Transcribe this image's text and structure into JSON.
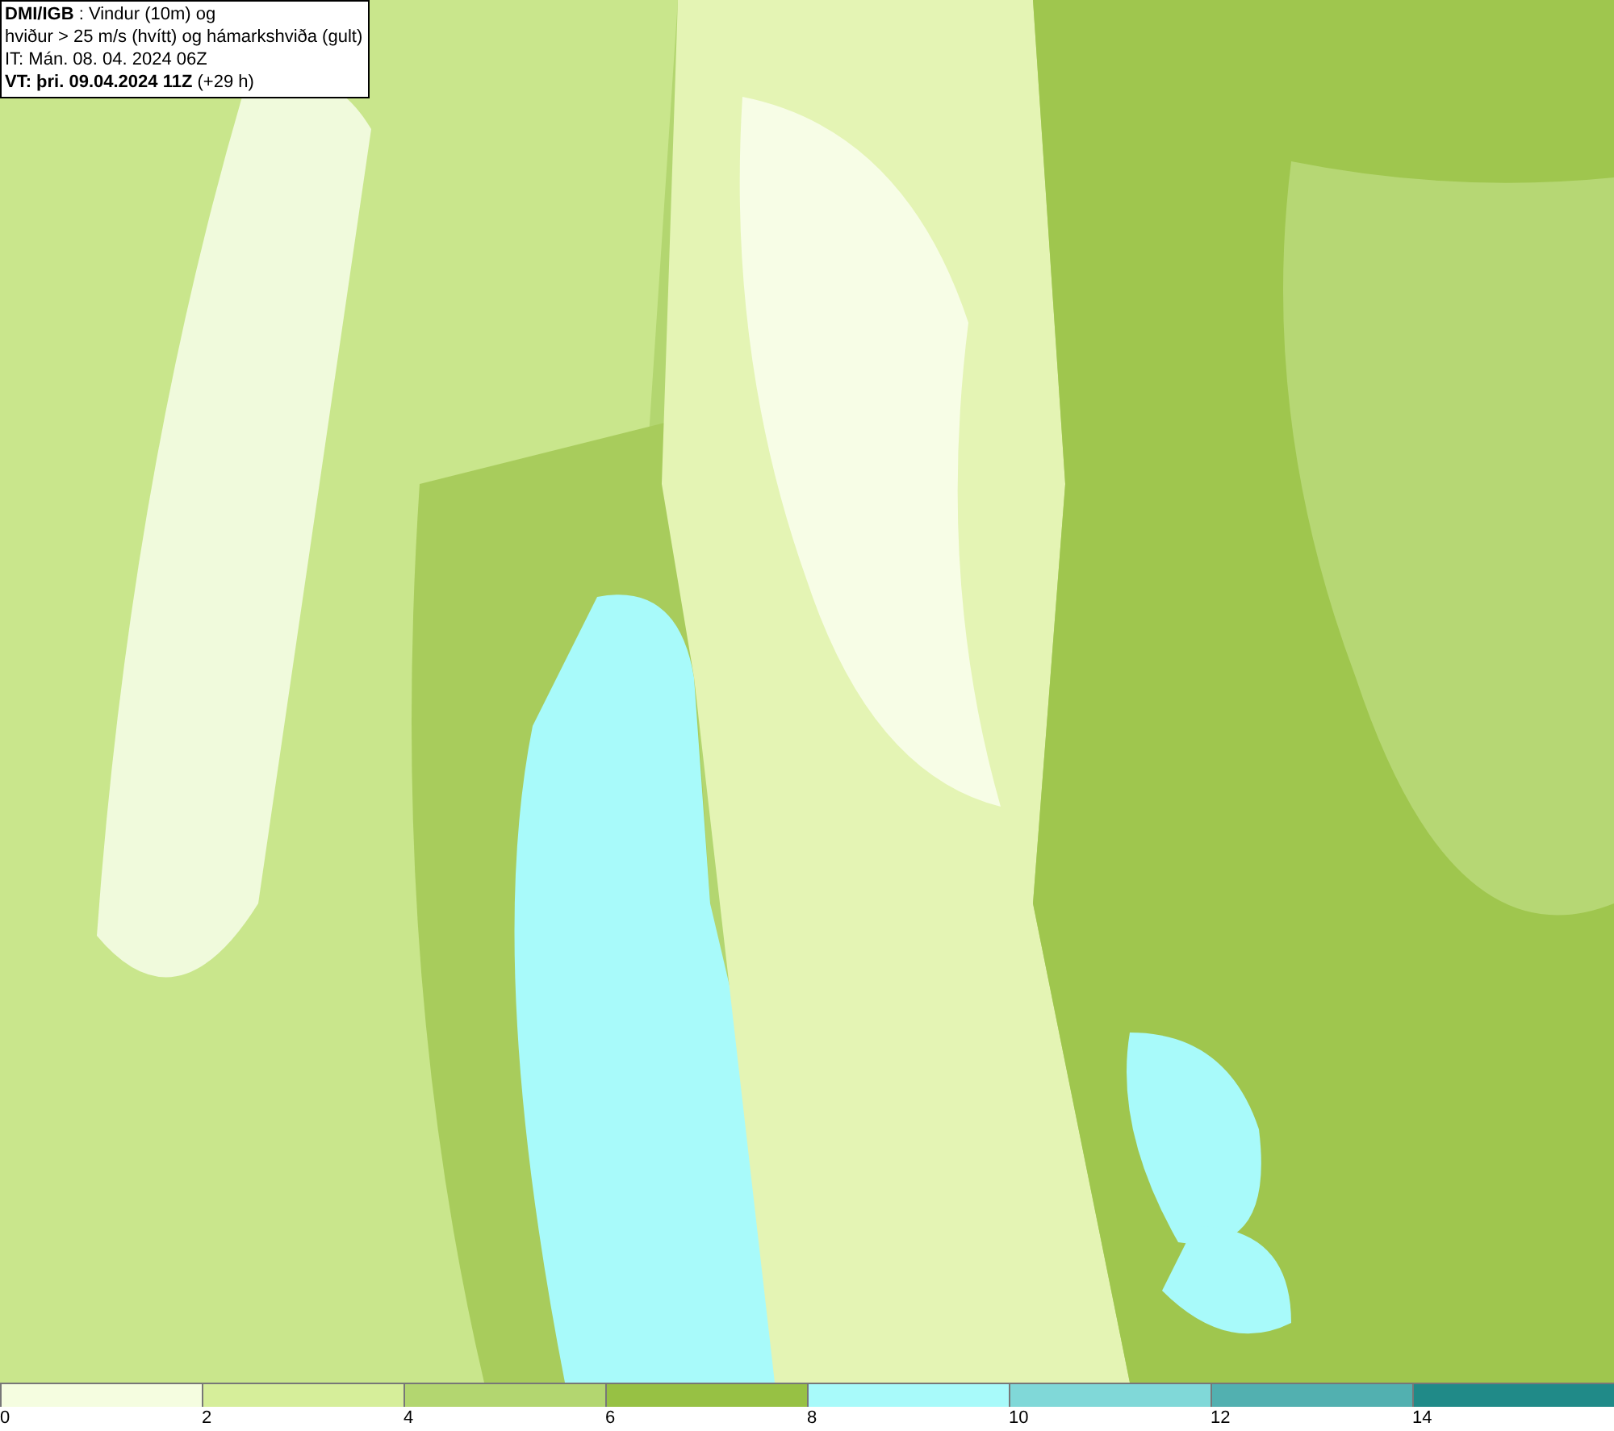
{
  "header": {
    "lines": [
      "**DMI/IGB** : Vindur (10m) og",
      "hviður > 25 m/s (hvítt) og hámarkshviða (gult)",
      "IT: Mán. 08. 04. 2024 06Z",
      "**VT: þri. 09.04.2024 11Z** (+29 h)"
    ]
  },
  "legend": {
    "bins": [
      {
        "label": "0",
        "color": "#f5fde0"
      },
      {
        "label": "2",
        "color": "#d6ee9a"
      },
      {
        "label": "4",
        "color": "#b3d670"
      },
      {
        "label": "6",
        "color": "#97c144"
      },
      {
        "label": "8",
        "color": "#a8fafa"
      },
      {
        "label": "10",
        "color": "#80d8d8"
      },
      {
        "label": "12",
        "color": "#52b0b0"
      },
      {
        "label": "14",
        "color": "#208a88"
      }
    ]
  }
}
